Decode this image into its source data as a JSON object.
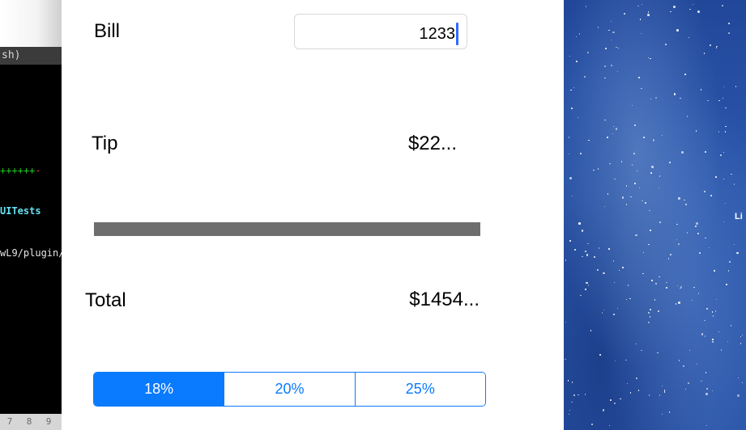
{
  "terminal": {
    "title_fragment": "sh)",
    "dashes_green": "++++++",
    "dashes_red": "-",
    "tests_text": "UITests",
    "path_text": "wL9/plugin/",
    "bottom_keys": [
      "7",
      "8",
      "9"
    ]
  },
  "app": {
    "bill_label": "Bill",
    "bill_value": "1233",
    "tip_label": "Tip",
    "tip_value": "$22...",
    "total_label": "Total",
    "total_value": "$1454...",
    "tip_options": [
      "18%",
      "20%",
      "25%"
    ],
    "selected_option": "18%",
    "accent_color": "#0a7aff"
  },
  "desktop": {
    "label_fragment": "Li"
  }
}
